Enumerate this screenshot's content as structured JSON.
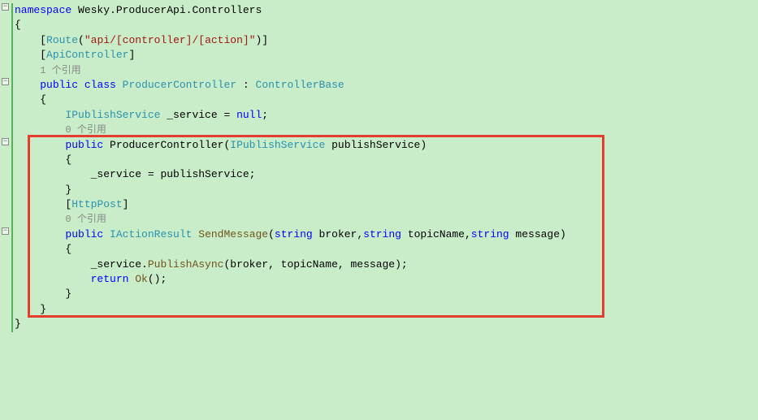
{
  "lines": {
    "l0": {
      "pre": "",
      "p1": "namespace",
      "p2": " Wesky.ProducerApi.Controllers"
    },
    "l1": {
      "pre": "",
      "p1": "{"
    },
    "l2": {
      "pre": "    ",
      "p1": "[",
      "p2": "Route",
      "p3": "(",
      "p4": "\"api/[controller]/[action]\"",
      "p5": ")]"
    },
    "l3": {
      "pre": "    ",
      "p1": "[",
      "p2": "ApiController",
      "p3": "]"
    },
    "l4": {
      "pre": "    ",
      "p1": "1 个引用"
    },
    "l5": {
      "pre": "    ",
      "p1": "public",
      "p2": " ",
      "p3": "class",
      "p4": " ",
      "p5": "ProducerController",
      "p6": " : ",
      "p7": "ControllerBase"
    },
    "l6": {
      "pre": "    ",
      "p1": "{"
    },
    "l7": {
      "pre": "        ",
      "p1": "IPublishService",
      "p2": " _service = ",
      "p3": "null",
      "p4": ";"
    },
    "l8": {
      "pre": "        ",
      "p1": "0 个引用"
    },
    "l9": {
      "pre": "        ",
      "p1": "public",
      "p2": " ProducerController(",
      "p3": "IPublishService",
      "p4": " publishService)"
    },
    "l10": {
      "pre": "        ",
      "p1": "{"
    },
    "l11": {
      "pre": "            ",
      "p1": "_service = publishService;"
    },
    "l12": {
      "pre": "        ",
      "p1": "}"
    },
    "l13": {
      "pre": "        ",
      "p1": "[",
      "p2": "HttpPost",
      "p3": "]"
    },
    "l14": {
      "pre": "        ",
      "p1": "0 个引用"
    },
    "l15": {
      "pre": "        ",
      "p1": "public",
      "p2": " ",
      "p3": "IActionResult",
      "p4": " ",
      "p5": "SendMessage",
      "p6": "(",
      "p7": "string",
      "p8": " broker,",
      "p9": "string",
      "p10": " topicName,",
      "p11": "string",
      "p12": " message)"
    },
    "l16": {
      "pre": "        ",
      "p1": "{"
    },
    "l17": {
      "pre": "            ",
      "p1": "_service.",
      "p2": "PublishAsync",
      "p3": "(broker, topicName, message);"
    },
    "l18": {
      "pre": "            ",
      "p1": "return",
      "p2": " ",
      "p3": "Ok",
      "p4": "();"
    },
    "l19": {
      "pre": "        ",
      "p1": "}"
    },
    "l20": {
      "pre": "    ",
      "p1": "}"
    },
    "l21": {
      "pre": "",
      "p1": "}"
    }
  },
  "fold": {
    "minus": "−"
  }
}
